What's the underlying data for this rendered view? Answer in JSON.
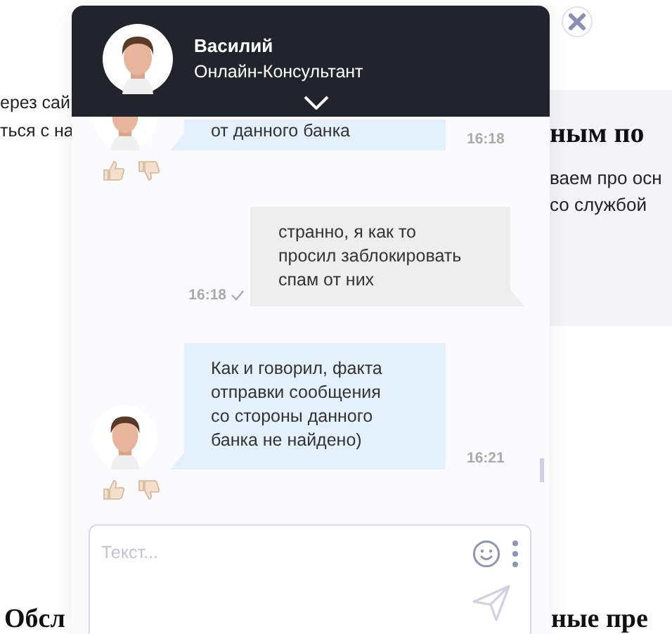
{
  "background_page": {
    "left_lines": [
      "ерез сай",
      "ться с на"
    ],
    "right_panel": {
      "heading": "ным по",
      "lines": [
        "ваем про осн",
        "со службой"
      ]
    },
    "bottom_left": "Обсл",
    "bottom_right": "ные пре"
  },
  "chat": {
    "header": {
      "name": "Василий",
      "role": "Онлайн-Консультант"
    },
    "messages": [
      {
        "kind": "operator",
        "text": "от данного банка",
        "time": "16:18"
      },
      {
        "kind": "user",
        "text": "странно, я как то\nпросил заблокировать\nспам от них",
        "time": "16:18",
        "delivered": true
      },
      {
        "kind": "operator",
        "text": "Как и говорил, факта\nотправки сообщения\nсо стороны данного\nбанка не найдено)",
        "time": "16:21"
      }
    ],
    "composer": {
      "placeholder": "Текст..."
    }
  }
}
